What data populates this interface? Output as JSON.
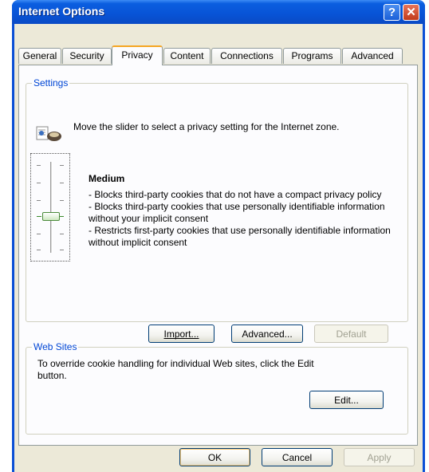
{
  "window": {
    "title": "Internet Options",
    "help_icon": "question-mark-icon",
    "close_icon": "close-x-icon"
  },
  "tabs": [
    {
      "label": "General",
      "active": false
    },
    {
      "label": "Security",
      "active": false
    },
    {
      "label": "Privacy",
      "active": true
    },
    {
      "label": "Content",
      "active": false
    },
    {
      "label": "Connections",
      "active": false
    },
    {
      "label": "Programs",
      "active": false
    },
    {
      "label": "Advanced",
      "active": false
    }
  ],
  "settings": {
    "group_label": "Settings",
    "intro": "Move the slider to select a privacy setting for the Internet zone.",
    "icon": "privacy-globe-icon",
    "level": "Medium",
    "slider_level_fraction": 0.6,
    "description_lines": [
      "- Blocks third-party cookies that do not have a compact privacy policy",
      "- Blocks third-party cookies that use personally identifiable information without your implicit consent",
      "- Restricts first-party cookies that use personally identifiable information without implicit consent"
    ],
    "buttons": {
      "import": "Import...",
      "advanced": "Advanced...",
      "default": "Default"
    }
  },
  "websites": {
    "group_label": "Web Sites",
    "text": "To override cookie handling for individual Web sites, click the Edit button.",
    "edit_button": "Edit..."
  },
  "footer": {
    "ok": "OK",
    "cancel": "Cancel",
    "apply": "Apply"
  },
  "colors": {
    "titlebar": "#0853d6",
    "dialog_bg": "#ece9d8",
    "group_label": "#0046d5",
    "active_tab_highlight": "#f5a623"
  }
}
